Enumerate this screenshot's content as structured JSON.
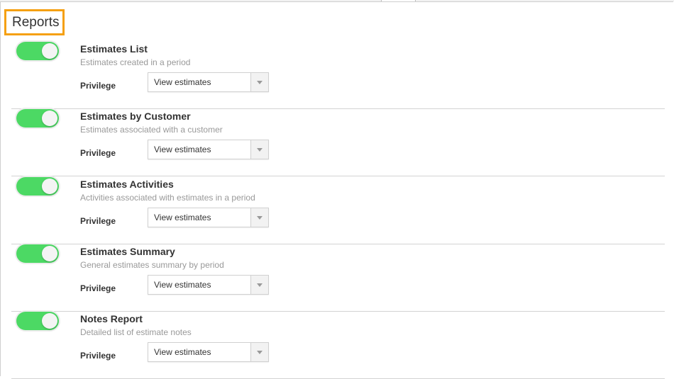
{
  "section": {
    "title": "Reports",
    "highlight_color": "#f5a011"
  },
  "toggle_on_color": "#4cd964",
  "reports": [
    {
      "name": "Estimates List",
      "description": "Estimates created in a period",
      "enabled": true,
      "privilege_label": "Privilege",
      "privilege_value": "View estimates"
    },
    {
      "name": "Estimates by Customer",
      "description": "Estimates associated with a customer",
      "enabled": true,
      "privilege_label": "Privilege",
      "privilege_value": "View estimates"
    },
    {
      "name": "Estimates Activities",
      "description": "Activities associated with estimates in a period",
      "enabled": true,
      "privilege_label": "Privilege",
      "privilege_value": "View estimates"
    },
    {
      "name": "Estimates Summary",
      "description": "General estimates summary by period",
      "enabled": true,
      "privilege_label": "Privilege",
      "privilege_value": "View estimates"
    },
    {
      "name": "Notes Report",
      "description": "Detailed list of estimate notes",
      "enabled": true,
      "privilege_label": "Privilege",
      "privilege_value": "View estimates"
    }
  ]
}
